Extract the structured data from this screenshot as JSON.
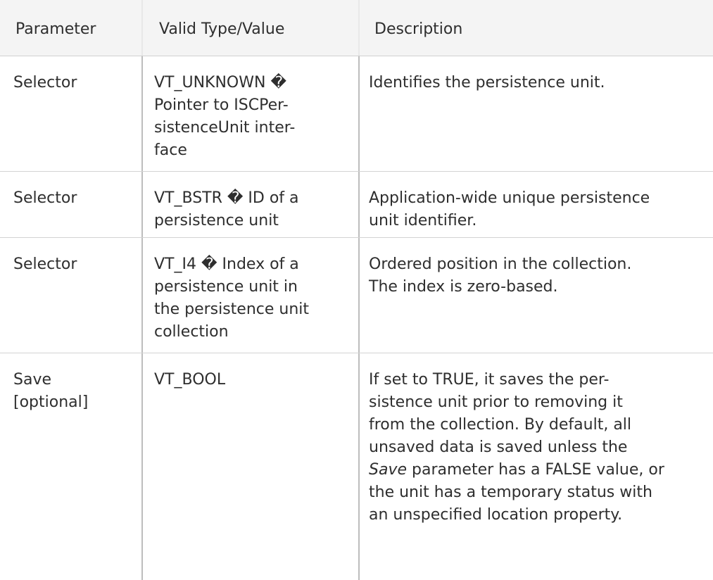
{
  "table": {
    "headers": [
      "Parameter",
      "Valid Type/Value",
      "Description"
    ],
    "rows": [
      {
        "parameter": "Selector",
        "type_lines": [
          "VT_UNKNOWN �",
          "Pointer to ISCPer-",
          "sistenceUnit inter-",
          "face"
        ],
        "description_lines": [
          "Identifies the persistence unit."
        ]
      },
      {
        "parameter": "Selector",
        "type_lines": [
          "VT_BSTR � ID of a",
          "persistence unit"
        ],
        "description_lines": [
          "Application-wide unique persistence",
          "unit identifier."
        ]
      },
      {
        "parameter": "Selector",
        "type_lines": [
          "VT_I4 � Index of a",
          "persistence unit in",
          "the persistence unit",
          "collection"
        ],
        "description_lines": [
          "Ordered position in the collection.",
          "The index is zero-based."
        ]
      },
      {
        "parameter_lines": [
          "Save",
          "[optional]"
        ],
        "type_lines": [
          "VT_BOOL"
        ],
        "description_lines": [
          "If set to TRUE, it saves the per-",
          "sistence unit prior to removing it",
          "from the collection. By default, all",
          "unsaved data is saved unless the"
        ],
        "description_italic": "Save",
        "description_after_italic": " parameter has a FALSE value, or",
        "description_tail_lines": [
          "the unit has a temporary status with",
          "an unspecified location property."
        ]
      }
    ]
  }
}
